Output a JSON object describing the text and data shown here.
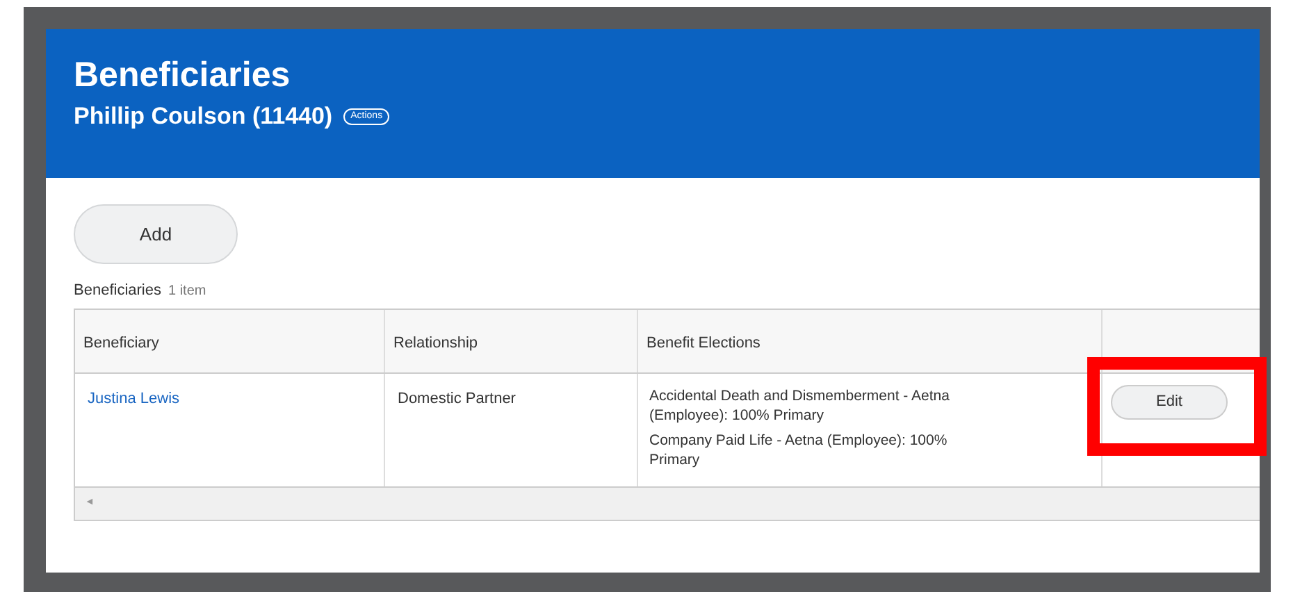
{
  "header": {
    "title": "Beneficiaries",
    "subtitle": "Phillip Coulson (11440)",
    "actions_button": "Actions"
  },
  "add_button": "Add",
  "table": {
    "title": "Beneficiaries",
    "count": "1 item",
    "columns": [
      "Beneficiary",
      "Relationship",
      "Benefit Elections"
    ],
    "rows": [
      {
        "beneficiary": "Justina Lewis",
        "relationship": "Domestic Partner",
        "elections": [
          "Accidental Death and Dismemberment - Aetna (Employee): 100% Primary",
          "Company Paid Life - Aetna (Employee): 100% Primary"
        ],
        "action": "Edit",
        "highlighted": true
      }
    ],
    "scroll_left": "◄"
  }
}
